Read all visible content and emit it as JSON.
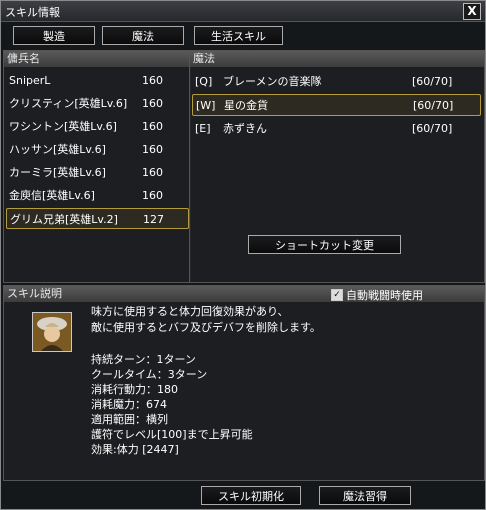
{
  "window": {
    "title": "スキル情報",
    "close_label": "X"
  },
  "tabs": {
    "craft": "製造",
    "magic": "魔法",
    "life": "生活スキル"
  },
  "mercenary": {
    "header": "傭兵名",
    "rows": [
      {
        "name": "SniperL",
        "level": "160"
      },
      {
        "name": "クリスティン[英雄Lv.6]",
        "level": "160"
      },
      {
        "name": "ワシントン[英雄Lv.6]",
        "level": "160"
      },
      {
        "name": "ハッサン[英雄Lv.6]",
        "level": "160"
      },
      {
        "name": "カーミラ[英雄Lv.6]",
        "level": "160"
      },
      {
        "name": "金庾信[英雄Lv.6]",
        "level": "160"
      },
      {
        "name": "グリム兄弟[英雄Lv.2]",
        "level": "127"
      }
    ]
  },
  "magic": {
    "header": "魔法",
    "rows": [
      {
        "key": "[Q]",
        "name": "ブレーメンの音楽隊",
        "level": "[60/70]"
      },
      {
        "key": "[W]",
        "name": "星の金貨",
        "level": "[60/70]"
      },
      {
        "key": "[E]",
        "name": "赤ずきん",
        "level": "[60/70]"
      }
    ],
    "shortcut_button": "ショートカット変更"
  },
  "skill_desc": {
    "header": "スキル説明",
    "auto_label": "自動戦闘時使用",
    "line1": "味方に使用すると体力回復効果があり、",
    "line2": "敵に使用するとバフ及びデバフを削除します。",
    "stats": [
      "持続ターン：1ターン",
      "クールタイム：3ターン",
      "消耗行動力：180",
      "消耗魔力：674",
      "適用範囲：横列",
      "護符でレベル[100]まで上昇可能",
      "効果:体力 [2447]"
    ]
  },
  "footer": {
    "reset": "スキル初期化",
    "learn": "魔法習得"
  },
  "colors": {
    "selected_border": "#b59b3a",
    "panel_header": "#4a4a4a"
  }
}
